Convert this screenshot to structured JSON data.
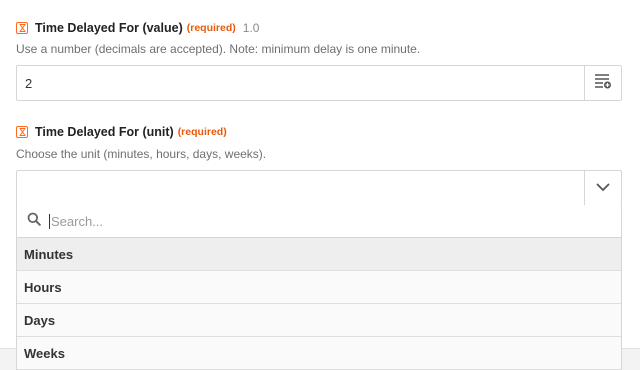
{
  "field_value": {
    "icon": "hourglass-icon",
    "label": "Time Delayed For (value)",
    "required": "(required)",
    "version": "1.0",
    "help": "Use a number (decimals are accepted). Note: minimum delay is one minute.",
    "input_value": "2",
    "side_icon": "insert-data-icon"
  },
  "field_unit": {
    "icon": "hourglass-icon",
    "label": "Time Delayed For (unit)",
    "required": "(required)",
    "help": "Choose the unit (minutes, hours, days, weeks).",
    "selected": "",
    "side_icon": "chevron-down-icon"
  },
  "dropdown": {
    "search_placeholder": "Search...",
    "options": [
      {
        "label": "Minutes"
      },
      {
        "label": "Hours"
      },
      {
        "label": "Days"
      },
      {
        "label": "Weeks"
      }
    ]
  },
  "colors": {
    "accent": "#ff6a1e",
    "required": "#e8590c"
  }
}
